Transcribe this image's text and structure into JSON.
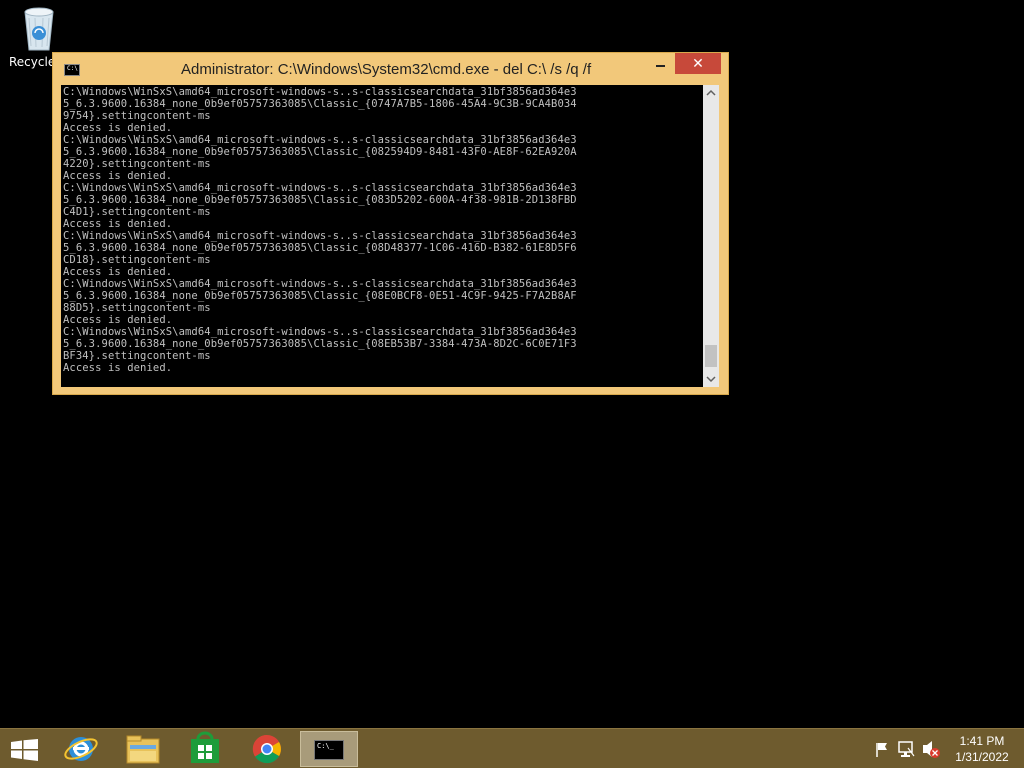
{
  "desktop": {
    "recycle_bin_label": "Recycle"
  },
  "window": {
    "title": "Administrator: C:\\Windows\\System32\\cmd.exe - del  C:\\ /s /q /f",
    "close_glyph": "✕",
    "console_lines": [
      "C:\\Windows\\WinSxS\\amd64_microsoft-windows-s..s-classicsearchdata_31bf3856ad364e3",
      "5_6.3.9600.16384_none_0b9ef05757363085\\Classic_{0747A7B5-1806-45A4-9C3B-9CA4B034",
      "9754}.settingcontent-ms",
      "Access is denied.",
      "C:\\Windows\\WinSxS\\amd64_microsoft-windows-s..s-classicsearchdata_31bf3856ad364e3",
      "5_6.3.9600.16384_none_0b9ef05757363085\\Classic_{082594D9-8481-43F0-AE8F-62EA920A",
      "4220}.settingcontent-ms",
      "Access is denied.",
      "C:\\Windows\\WinSxS\\amd64_microsoft-windows-s..s-classicsearchdata_31bf3856ad364e3",
      "5_6.3.9600.16384_none_0b9ef05757363085\\Classic_{083D5202-600A-4f38-981B-2D138FBD",
      "C4D1}.settingcontent-ms",
      "Access is denied.",
      "C:\\Windows\\WinSxS\\amd64_microsoft-windows-s..s-classicsearchdata_31bf3856ad364e3",
      "5_6.3.9600.16384_none_0b9ef05757363085\\Classic_{08D48377-1C06-416D-B382-61E8D5F6",
      "CD18}.settingcontent-ms",
      "Access is denied.",
      "C:\\Windows\\WinSxS\\amd64_microsoft-windows-s..s-classicsearchdata_31bf3856ad364e3",
      "5_6.3.9600.16384_none_0b9ef05757363085\\Classic_{08E0BCF8-0E51-4C9F-9425-F7A2B8AF",
      "88D5}.settingcontent-ms",
      "Access is denied.",
      "C:\\Windows\\WinSxS\\amd64_microsoft-windows-s..s-classicsearchdata_31bf3856ad364e3",
      "5_6.3.9600.16384_none_0b9ef05757363085\\Classic_{08EB53B7-3384-473A-8D2C-6C0E71F3",
      "BF34}.settingcontent-ms",
      "Access is denied."
    ]
  },
  "taskbar": {
    "pinned": [
      {
        "name": "internet-explorer-icon"
      },
      {
        "name": "file-explorer-icon"
      },
      {
        "name": "windows-store-icon"
      },
      {
        "name": "chrome-icon"
      },
      {
        "name": "command-prompt-icon",
        "active": true,
        "glyph": "C:\\_"
      }
    ],
    "tray_icons": [
      "action-center-flag-icon",
      "network-icon",
      "volume-muted-icon"
    ],
    "time": "1:41 PM",
    "date": "1/31/2022"
  },
  "colors": {
    "desktop_bg": "#000000",
    "window_frame": "#f2c87a",
    "close_button": "#c7493a",
    "console_bg": "#000000",
    "console_text": "#c0c0c0",
    "taskbar_bg": "#6e5b2e"
  }
}
